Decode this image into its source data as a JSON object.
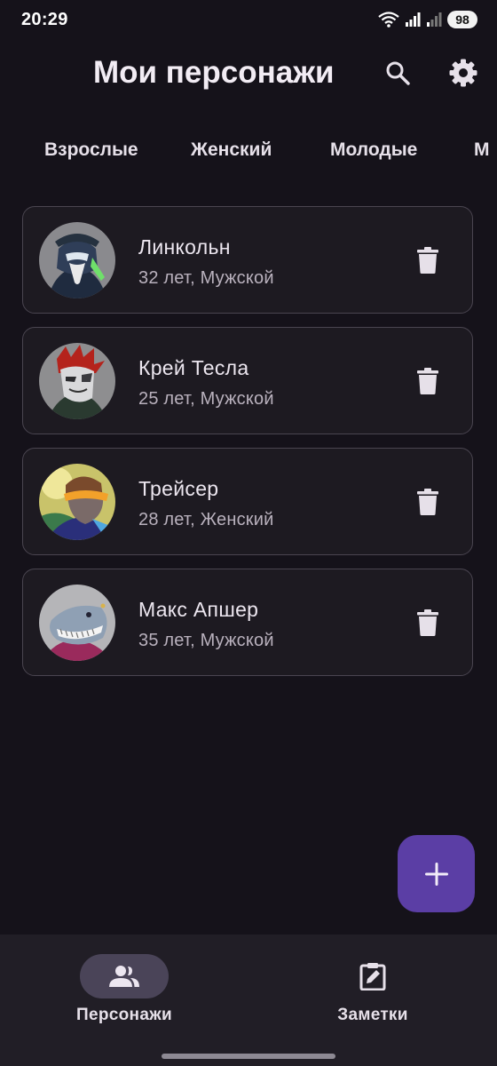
{
  "status_bar": {
    "time": "20:29",
    "battery": "98"
  },
  "header": {
    "title": "Мои персонажи",
    "search_icon": "search-icon",
    "settings_icon": "gear-icon"
  },
  "filters": [
    "Взрослые",
    "Женский",
    "Молодые",
    "М"
  ],
  "characters": [
    {
      "name": "Линкольн",
      "meta": "32 лет, Мужской"
    },
    {
      "name": "Крей Тесла",
      "meta": "25 лет, Мужской"
    },
    {
      "name": "Трейсер",
      "meta": "28 лет, Женский"
    },
    {
      "name": "Макс Апшер",
      "meta": "35 лет, Мужской"
    }
  ],
  "fab": {
    "icon": "plus-icon"
  },
  "bottom_nav": [
    {
      "label": "Персонажи",
      "icon": "people-icon",
      "active": true
    },
    {
      "label": "Заметки",
      "icon": "clipboard-edit-icon",
      "active": false
    }
  ],
  "colors": {
    "background": "#15121a",
    "card": "#1d1a21",
    "fab": "#5b3ea5",
    "nav_active": "#4a4458"
  }
}
